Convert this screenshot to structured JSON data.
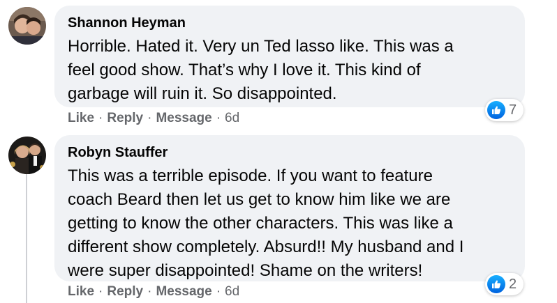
{
  "comments": [
    {
      "author": "Shannon Heyman",
      "text": "Horrible. Hated it. Very un Ted lasso like. This was a\nfeel good show. That’s why I love it. This kind of\ngarbage will ruin it. So disappointed.",
      "actions": {
        "like": "Like",
        "reply": "Reply",
        "message": "Message",
        "time": "6d",
        "separator": "·"
      },
      "reaction_count": "7"
    },
    {
      "author": "Robyn Stauffer",
      "text": "This was a terrible episode. If you want to feature\ncoach Beard then let us get to know him like we are\ngetting to know the other characters. This was like a\ndifferent show completely. Absurd!! My husband and I\nwere super disappointed! Shame on the writers!",
      "actions": {
        "like": "Like",
        "reply": "Reply",
        "message": "Message",
        "time": "6d",
        "separator": "·"
      },
      "reaction_count": "2"
    }
  ],
  "colors": {
    "bubble": "#f0f2f5",
    "meta_text": "#65676b",
    "like_blue": "#1877f2"
  },
  "icons": {
    "reaction": "like-thumbs-up-icon"
  }
}
